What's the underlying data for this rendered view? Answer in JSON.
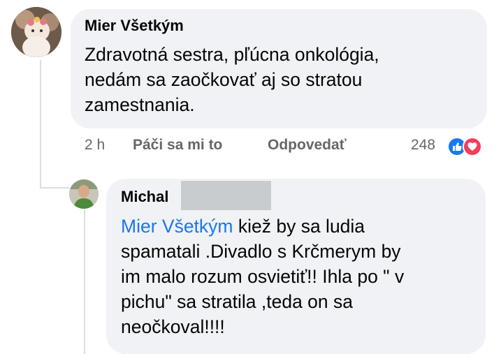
{
  "comment": {
    "author": "Mier Všetkým",
    "text": "Zdravotná sestra, pľúcna onkológia,\nnedám sa zaočkovať aj so stratou\nzamestnania.",
    "actions": {
      "time": "2 h",
      "like": "Páči sa mi to",
      "reply": "Odpovedať"
    },
    "reaction_count": "248",
    "reactions": [
      "like-icon",
      "love-icon"
    ]
  },
  "reply": {
    "author": "Michal",
    "mention": "Mier Všetkým",
    "text_after_mention": " kiež by sa ludia\nspamatali  .Divadlo s Krčmerym by\nim malo rozum osvietiť!! Ihla po \" v\npichu\" sa stratila ,teda on sa\nneočkoval!!!!"
  },
  "colors": {
    "bubble": "#f0f2f5",
    "mention": "#1877f2",
    "meta": "#65676b",
    "like": "#1877f2",
    "love": "#f33e58"
  }
}
